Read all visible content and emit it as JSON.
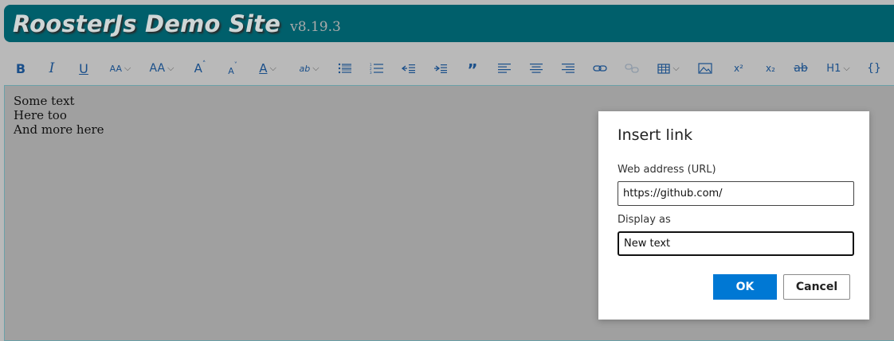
{
  "header": {
    "title": "RoosterJs Demo Site",
    "version": "v8.19.3"
  },
  "ribbon": {
    "bold": "B",
    "italic": "I",
    "underline": "U",
    "font": "AA",
    "size": "AA",
    "increase": "A",
    "decrease": "A",
    "color": "A",
    "background": "ab",
    "quote": "”",
    "superscript": "x²",
    "subscript": "x₂",
    "strike": "ab",
    "header": "H1",
    "code": "{}"
  },
  "editor": {
    "lines": [
      "Some text",
      "Here too",
      "And more here"
    ]
  },
  "dialog": {
    "title": "Insert link",
    "url_label": "Web address (URL)",
    "url_value": "https://github.com/",
    "display_label": "Display as",
    "display_value": "New text",
    "ok": "OK",
    "cancel": "Cancel"
  },
  "colors": {
    "header_bg": "#005f6b",
    "accent": "#0078d4",
    "icon": "#1a4f8a"
  }
}
